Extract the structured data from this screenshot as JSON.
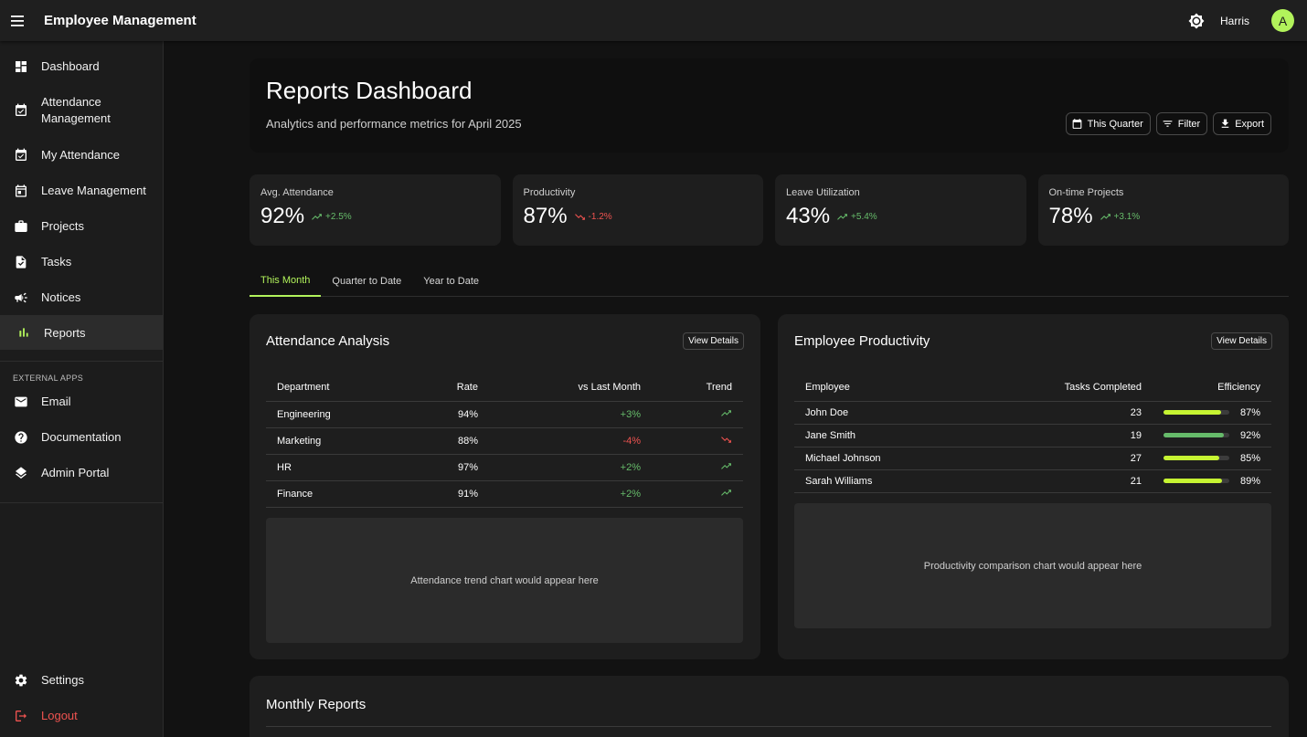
{
  "topbar": {
    "title": "Employee Management",
    "user_name": "Harris",
    "avatar_letter": "A",
    "avatar_color": "#b2f35b"
  },
  "sidebar": {
    "items": [
      {
        "label": "Dashboard",
        "icon": "dashboard-icon"
      },
      {
        "label": "Attendance Management",
        "icon": "calendar-check-icon"
      },
      {
        "label": "My Attendance",
        "icon": "calendar-check-icon"
      },
      {
        "label": "Leave Management",
        "icon": "calendar-event-icon"
      },
      {
        "label": "Projects",
        "icon": "briefcase-icon"
      },
      {
        "label": "Tasks",
        "icon": "task-file-icon"
      },
      {
        "label": "Notices",
        "icon": "megaphone-icon"
      },
      {
        "label": "Reports",
        "icon": "bar-chart-icon",
        "active": true
      }
    ],
    "external_label": "EXTERNAL APPS",
    "external": [
      {
        "label": "Email",
        "icon": "mail-icon"
      },
      {
        "label": "Documentation",
        "icon": "help-circle-icon"
      },
      {
        "label": "Admin Portal",
        "icon": "layers-icon"
      }
    ],
    "settings_label": "Settings",
    "logout_label": "Logout"
  },
  "header": {
    "title": "Reports Dashboard",
    "subtitle": "Analytics and performance metrics for April 2025",
    "actions": {
      "period": "This Quarter",
      "filter": "Filter",
      "export": "Export"
    }
  },
  "kpis": [
    {
      "label": "Avg. Attendance",
      "value": "92%",
      "change": "+2.5%",
      "direction": "up"
    },
    {
      "label": "Productivity",
      "value": "87%",
      "change": "-1.2%",
      "direction": "down"
    },
    {
      "label": "Leave Utilization",
      "value": "43%",
      "change": "+5.4%",
      "direction": "up"
    },
    {
      "label": "On-time Projects",
      "value": "78%",
      "change": "+3.1%",
      "direction": "up"
    }
  ],
  "tabs": [
    "This Month",
    "Quarter to Date",
    "Year to Date"
  ],
  "attendance": {
    "title": "Attendance Analysis",
    "view_label": "View Details",
    "columns": [
      "Department",
      "Rate",
      "vs Last Month",
      "Trend"
    ],
    "rows": [
      {
        "department": "Engineering",
        "rate": "94%",
        "change": "+3%",
        "trend": "up"
      },
      {
        "department": "Marketing",
        "rate": "88%",
        "change": "-4%",
        "trend": "down"
      },
      {
        "department": "HR",
        "rate": "97%",
        "change": "+2%",
        "trend": "up"
      },
      {
        "department": "Finance",
        "rate": "91%",
        "change": "+2%",
        "trend": "up"
      }
    ],
    "chart_placeholder": "Attendance trend chart would appear here"
  },
  "productivity": {
    "title": "Employee Productivity",
    "view_label": "View Details",
    "columns": [
      "Employee",
      "Tasks Completed",
      "Efficiency"
    ],
    "rows": [
      {
        "name": "John Doe",
        "tasks": "23",
        "efficiency": "87%",
        "fraction": 0.87,
        "color": "#c6f432"
      },
      {
        "name": "Jane Smith",
        "tasks": "19",
        "efficiency": "92%",
        "fraction": 0.92,
        "color": "#66bb6a"
      },
      {
        "name": "Michael Johnson",
        "tasks": "27",
        "efficiency": "85%",
        "fraction": 0.85,
        "color": "#c6f432"
      },
      {
        "name": "Sarah Williams",
        "tasks": "21",
        "efficiency": "89%",
        "fraction": 0.89,
        "color": "#c6f432"
      }
    ],
    "chart_placeholder": "Productivity comparison chart would appear here"
  },
  "monthly_reports": {
    "title": "Monthly Reports"
  },
  "colors": {
    "accent": "#b2f35b",
    "up": "#66bb6a",
    "down": "#ef5350"
  }
}
